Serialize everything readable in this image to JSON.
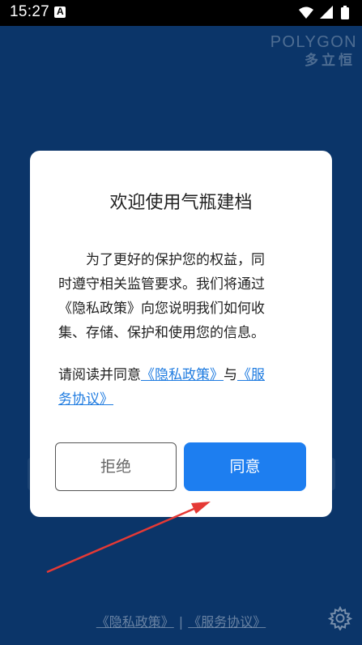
{
  "status_bar": {
    "time": "15:27",
    "notification_icon_letter": "A"
  },
  "brand": {
    "english": "POLYGON",
    "chinese": "多立恒"
  },
  "dialog": {
    "title": "欢迎使用气瓶建档",
    "body_line1": "为了更好的保护您的权益，同",
    "body_line2": "时遵守相关监管要求。我们将通过",
    "body_line3": "《隐私政策》向您说明我们如何收",
    "body_line4": "集、存储、保护和使用您的信息。",
    "consent_prefix": "请阅读并同意",
    "privacy_link": "《隐私政策》",
    "consent_and": "与",
    "terms_link_part1": "《服",
    "terms_link_part2": "务协议》",
    "reject_label": "拒绝",
    "agree_label": "同意"
  },
  "footer": {
    "privacy_link": "《隐私政策》",
    "separator": "|",
    "terms_link": "《服务协议》"
  },
  "colors": {
    "background": "#0b3569",
    "agree_button": "#1d7ef0",
    "link": "#1e7be0",
    "arrow": "#e53935"
  },
  "icons": {
    "wifi": "wifi-icon",
    "signal": "cell-signal-icon",
    "battery": "battery-icon",
    "settings": "gear-icon"
  }
}
